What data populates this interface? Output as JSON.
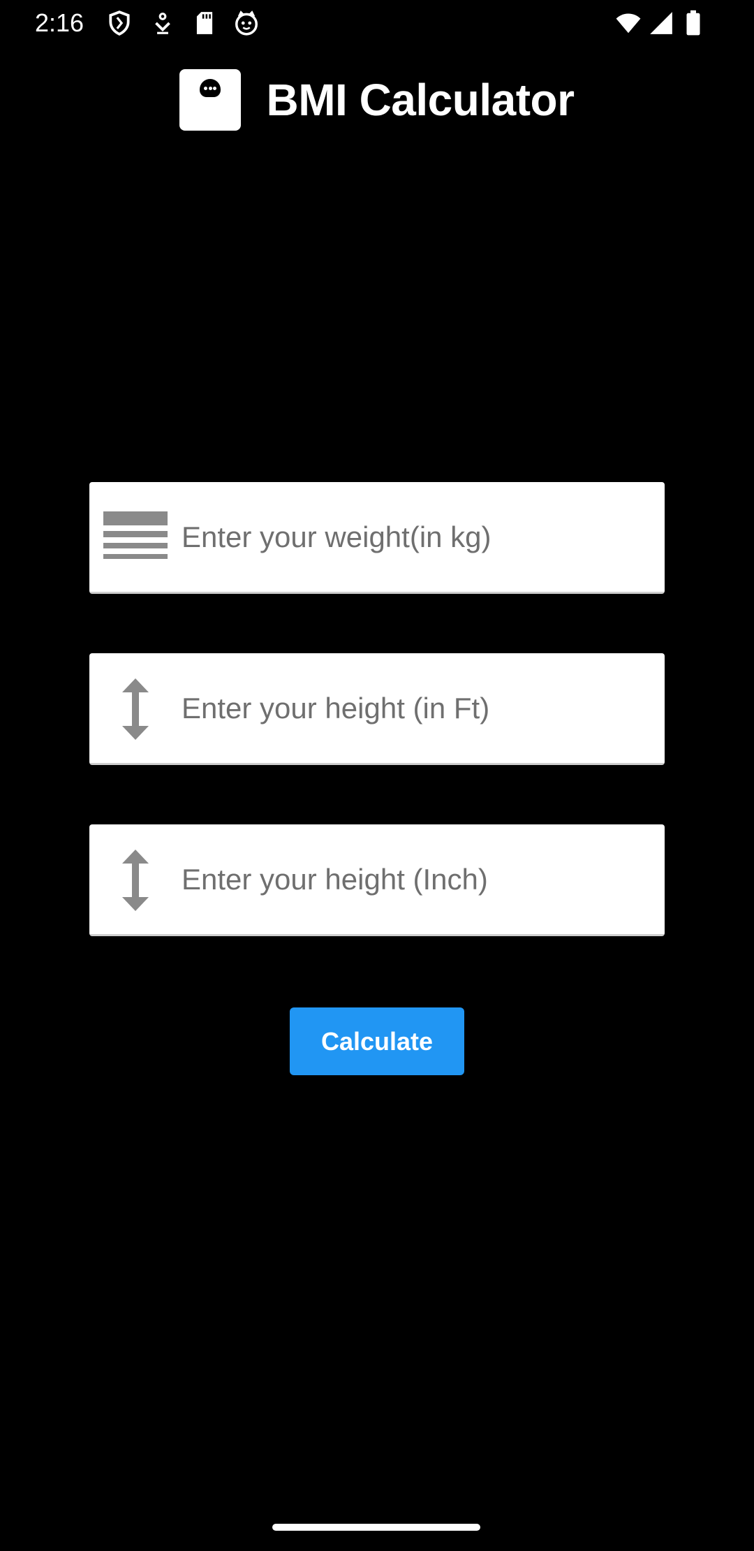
{
  "status_bar": {
    "time": "2:16",
    "icons": [
      "shield-icon",
      "download-icon",
      "sd-card-icon",
      "cat-face-icon",
      "wifi-icon",
      "signal-icon",
      "battery-icon"
    ]
  },
  "header": {
    "logo": "scale-icon",
    "title": "BMI Calculator"
  },
  "form": {
    "weight": {
      "placeholder": "Enter your weight(in kg)",
      "value": "",
      "icon": "weight-lines-icon"
    },
    "height_ft": {
      "placeholder": "Enter your height (in Ft)",
      "value": "",
      "icon": "vertical-arrows-icon"
    },
    "height_inch": {
      "placeholder": "Enter your height (Inch)",
      "value": "",
      "icon": "vertical-arrows-icon"
    }
  },
  "actions": {
    "calculate_label": "Calculate"
  },
  "colors": {
    "background": "#000000",
    "field_background": "#ffffff",
    "icon_gray": "#8a8a8a",
    "button_blue": "#2196f3",
    "text_white": "#ffffff"
  }
}
